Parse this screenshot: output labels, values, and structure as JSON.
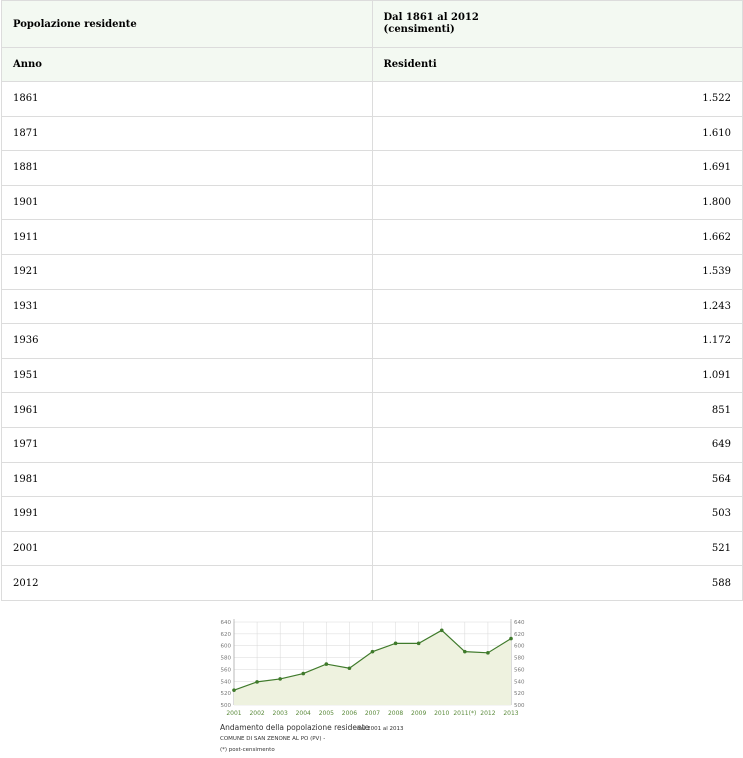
{
  "table": {
    "header_left": "Popolazione residente",
    "header_right_line1": "Dal 1861 al 2012",
    "header_right_line2": "(censimenti)",
    "col_year": "Anno",
    "col_residents": "Residenti",
    "rows": [
      {
        "year": "1861",
        "residents": "1.522"
      },
      {
        "year": "1871",
        "residents": "1.610"
      },
      {
        "year": "1881",
        "residents": "1.691"
      },
      {
        "year": "1901",
        "residents": "1.800"
      },
      {
        "year": "1911",
        "residents": "1.662"
      },
      {
        "year": "1921",
        "residents": "1.539"
      },
      {
        "year": "1931",
        "residents": "1.243"
      },
      {
        "year": "1936",
        "residents": "1.172"
      },
      {
        "year": "1951",
        "residents": "1.091"
      },
      {
        "year": "1961",
        "residents": "851"
      },
      {
        "year": "1971",
        "residents": "649"
      },
      {
        "year": "1981",
        "residents": "564"
      },
      {
        "year": "1991",
        "residents": "503"
      },
      {
        "year": "2001",
        "residents": "521"
      },
      {
        "year": "2012",
        "residents": "588"
      }
    ]
  },
  "chart_data": {
    "type": "area",
    "title": "Andamento della popolazione residente",
    "subtitle": "dal 2001 al 2013",
    "caption": "COMUNE DI SAN ZENONE AL PO (PV) -",
    "note": "(*) post-censimento",
    "categories": [
      "2001",
      "2002",
      "2003",
      "2004",
      "2005",
      "2006",
      "2007",
      "2008",
      "2009",
      "2010",
      "2011(*)",
      "2012",
      "2013"
    ],
    "values": [
      525,
      539,
      544,
      553,
      569,
      562,
      590,
      604,
      604,
      626,
      590,
      588,
      612
    ],
    "ylim": [
      500,
      640
    ],
    "yticks": [
      500,
      520,
      540,
      560,
      580,
      600,
      620,
      640
    ],
    "grid": true,
    "colors": {
      "line": "#3f7a2b",
      "fill": "#eef2df",
      "tick_label": "#5a8a3a",
      "grid": "#d8d8d8"
    }
  }
}
